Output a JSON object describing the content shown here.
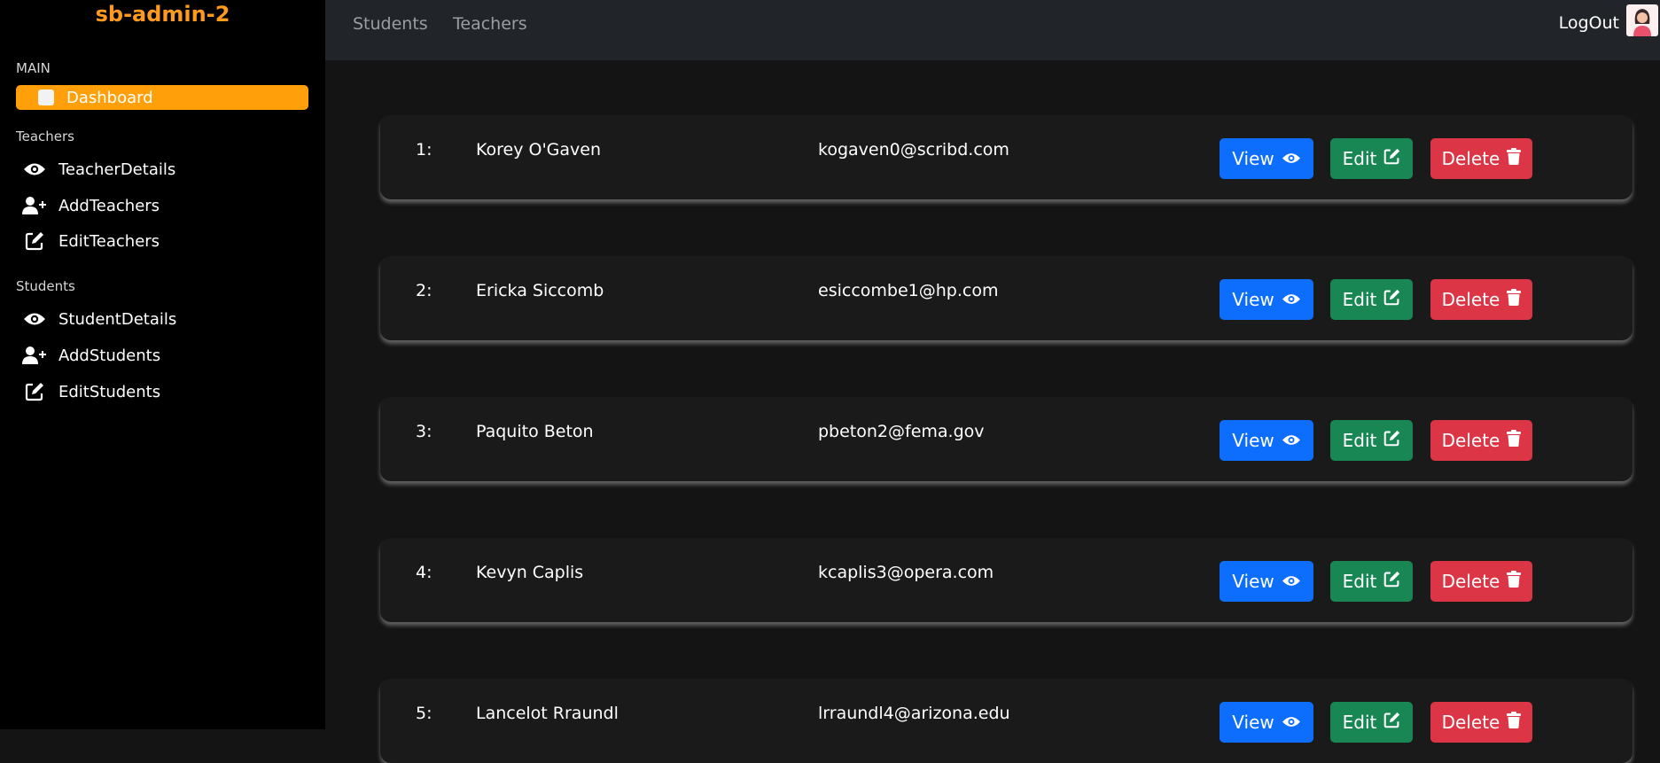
{
  "sidebar": {
    "brand": "sb-admin-2",
    "main_heading": "MAIN",
    "dashboard_label": "Dashboard",
    "teachers_heading": "Teachers",
    "students_heading": "Students",
    "items": [
      {
        "label": "TeacherDetails",
        "icon": "eye-icon"
      },
      {
        "label": "AddTeachers",
        "icon": "user-plus-icon"
      },
      {
        "label": "EditTeachers",
        "icon": "edit-icon"
      },
      {
        "label": "StudentDetails",
        "icon": "eye-icon"
      },
      {
        "label": "AddStudents",
        "icon": "user-plus-icon"
      },
      {
        "label": "EditStudents",
        "icon": "edit-icon"
      }
    ]
  },
  "topbar": {
    "links": [
      "Students",
      "Teachers"
    ],
    "logout": "LogOut"
  },
  "rows": [
    {
      "num": "1:",
      "name": "Korey O'Gaven",
      "email": "kogaven0@scribd.com"
    },
    {
      "num": "2:",
      "name": "Ericka Siccomb",
      "email": "esiccombe1@hp.com"
    },
    {
      "num": "3:",
      "name": "Paquito Beton",
      "email": "pbeton2@fema.gov"
    },
    {
      "num": "4:",
      "name": "Kevyn Caplis",
      "email": "kcaplis3@opera.com"
    },
    {
      "num": "5:",
      "name": "Lancelot Rraundl",
      "email": "lrraundl4@arizona.edu"
    }
  ],
  "actions": {
    "view": "View",
    "edit": "Edit",
    "delete": "Delete"
  },
  "colors": {
    "brand": "#ff9a1f",
    "dashboard": "#ffa00a",
    "view": "#0d6efd",
    "edit": "#198754",
    "delete": "#dc3545"
  }
}
